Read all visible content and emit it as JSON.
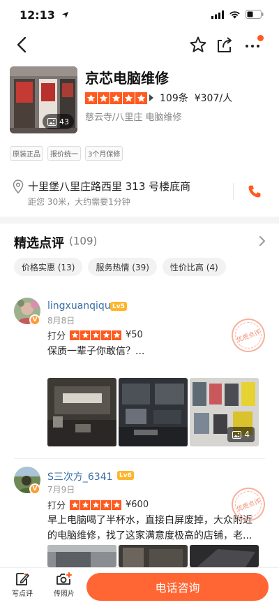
{
  "status_bar": {
    "time": "12:13"
  },
  "shop": {
    "name": "京芯电脑维修",
    "photo_count": "43",
    "review_count": "109条",
    "avg_price": "¥307/人",
    "rating_stars": 5,
    "category": "慈云寺/八里庄 电脑维修",
    "tags": [
      "原装正品",
      "报价统一",
      "3个月保修"
    ],
    "address": "十里堡八里庄路西里 313 号楼底商",
    "distance": "距您 30米，大约需要1分钟"
  },
  "reviews_section": {
    "title": "精选点评",
    "count": "(109)",
    "chips": [
      "价格实惠 (13)",
      "服务热情 (39)",
      "性价比高 (4)"
    ]
  },
  "reviews": [
    {
      "username": "lingxuanqiqu",
      "level": "Lv5",
      "date": "8月8日",
      "score_label": "打分",
      "price": "¥50",
      "text": "保质一辈子你敢信？...",
      "stamp": "优质点评",
      "image_count": "4"
    },
    {
      "username": "S三次方_6341",
      "level": "Lv6",
      "date": "7月9日",
      "score_label": "打分",
      "price": "¥600",
      "text_line1": "早上电脑喝了半杯水，直接白屏废掉，大众附近",
      "text_line2": "的电脑维修，找了这家满意度极高的店铺，老...",
      "stamp": "优质点评"
    }
  ],
  "bottom_bar": {
    "write_review": "写点评",
    "upload_photo": "传照片",
    "call_button": "电话咨询"
  },
  "colors": {
    "accent": "#ff5a1f",
    "link": "#3a6ea5",
    "level_badge": "#ffb52b"
  }
}
